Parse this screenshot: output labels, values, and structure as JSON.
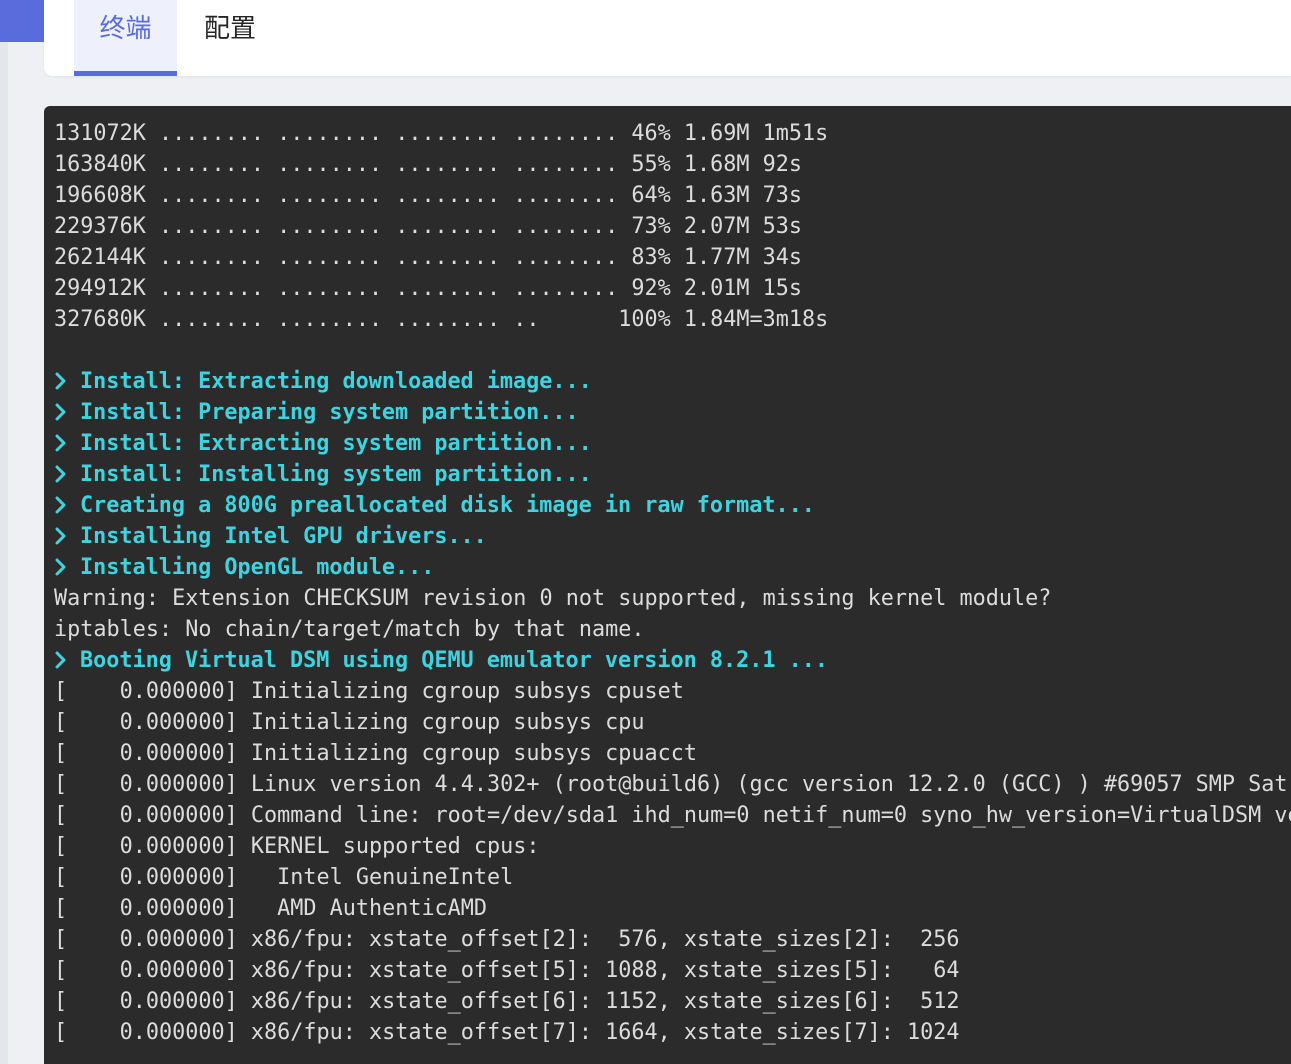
{
  "tabs": [
    {
      "label": "终端",
      "active": true
    },
    {
      "label": "配置",
      "active": false
    }
  ],
  "colors": {
    "accent": "#5a6bdc",
    "terminal_bg": "#2b2b2b",
    "terminal_text": "#dcdcdc",
    "info_text": "#3fd3e0"
  },
  "terminal": {
    "prompt_icon": "chevron-right-icon",
    "lines": [
      {
        "type": "plain",
        "text": "131072K ........ ........ ........ ........ 46% 1.69M 1m51s"
      },
      {
        "type": "plain",
        "text": "163840K ........ ........ ........ ........ 55% 1.68M 92s"
      },
      {
        "type": "plain",
        "text": "196608K ........ ........ ........ ........ 64% 1.63M 73s"
      },
      {
        "type": "plain",
        "text": "229376K ........ ........ ........ ........ 73% 2.07M 53s"
      },
      {
        "type": "plain",
        "text": "262144K ........ ........ ........ ........ 83% 1.77M 34s"
      },
      {
        "type": "plain",
        "text": "294912K ........ ........ ........ ........ 92% 2.01M 15s"
      },
      {
        "type": "plain",
        "text": "327680K ........ ........ ........ ..      100% 1.84M=3m18s"
      },
      {
        "type": "blank",
        "text": ""
      },
      {
        "type": "info",
        "text": "Install: Extracting downloaded image..."
      },
      {
        "type": "info",
        "text": "Install: Preparing system partition..."
      },
      {
        "type": "info",
        "text": "Install: Extracting system partition..."
      },
      {
        "type": "info",
        "text": "Install: Installing system partition..."
      },
      {
        "type": "info",
        "text": "Creating a 800G preallocated disk image in raw format..."
      },
      {
        "type": "info",
        "text": "Installing Intel GPU drivers..."
      },
      {
        "type": "info",
        "text": "Installing OpenGL module..."
      },
      {
        "type": "plain",
        "text": "Warning: Extension CHECKSUM revision 0 not supported, missing kernel module?"
      },
      {
        "type": "plain",
        "text": "iptables: No chain/target/match by that name."
      },
      {
        "type": "info",
        "text": "Booting Virtual DSM using QEMU emulator version 8.2.1 ..."
      },
      {
        "type": "plain",
        "text": "[    0.000000] Initializing cgroup subsys cpuset"
      },
      {
        "type": "plain",
        "text": "[    0.000000] Initializing cgroup subsys cpu"
      },
      {
        "type": "plain",
        "text": "[    0.000000] Initializing cgroup subsys cpuacct"
      },
      {
        "type": "plain",
        "text": "[    0.000000] Linux version 4.4.302+ (root@build6) (gcc version 12.2.0 (GCC) ) #69057 SMP Sat "
      },
      {
        "type": "plain",
        "text": "[    0.000000] Command line: root=/dev/sda1 ihd_num=0 netif_num=0 syno_hw_version=VirtualDSM ve"
      },
      {
        "type": "plain",
        "text": "[    0.000000] KERNEL supported cpus:"
      },
      {
        "type": "plain",
        "text": "[    0.000000]   Intel GenuineIntel"
      },
      {
        "type": "plain",
        "text": "[    0.000000]   AMD AuthenticAMD"
      },
      {
        "type": "plain",
        "text": "[    0.000000] x86/fpu: xstate_offset[2]:  576, xstate_sizes[2]:  256"
      },
      {
        "type": "plain",
        "text": "[    0.000000] x86/fpu: xstate_offset[5]: 1088, xstate_sizes[5]:   64"
      },
      {
        "type": "plain",
        "text": "[    0.000000] x86/fpu: xstate_offset[6]: 1152, xstate_sizes[6]:  512"
      },
      {
        "type": "plain",
        "text": "[    0.000000] x86/fpu: xstate_offset[7]: 1664, xstate_sizes[7]: 1024"
      }
    ]
  }
}
